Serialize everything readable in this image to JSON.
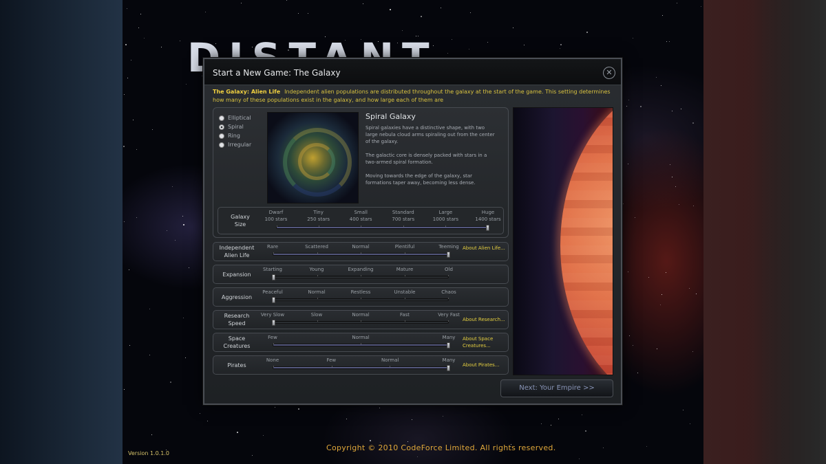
{
  "logo_text": "DISTANT",
  "version": "Version 1.0.1.0",
  "copyright": "Copyright © 2010 CodeForce Limited. All rights reserved.",
  "dialog": {
    "title": "Start a New Game: The Galaxy",
    "close_icon": "close-icon",
    "description_label": "The Galaxy: Alien Life",
    "description_text": "Independent alien populations are distributed throughout the galaxy at the start of the game. This setting determines how many of these populations exist in the galaxy, and how large each of them are",
    "galaxy_shapes": [
      {
        "label": "Elliptical",
        "selected": false
      },
      {
        "label": "Spiral",
        "selected": true
      },
      {
        "label": "Ring",
        "selected": false
      },
      {
        "label": "Irregular",
        "selected": false
      }
    ],
    "galaxy_heading": "Spiral Galaxy",
    "galaxy_paragraphs": [
      "Spiral galaxies have a distinctive shape, with two large nebula cloud arms spiraling out from the center of the galaxy.",
      "The galactic core is densely packed with stars in a two-armed spiral formation.",
      "Moving towards the edge of the galaxy, star formations taper away, becoming less dense."
    ],
    "galaxy_size": {
      "label": "Galaxy Size",
      "options": [
        {
          "name": "Dwarf",
          "stars": "100 stars"
        },
        {
          "name": "Tiny",
          "stars": "250 stars"
        },
        {
          "name": "Small",
          "stars": "400 stars"
        },
        {
          "name": "Standard",
          "stars": "700 stars"
        },
        {
          "name": "Large",
          "stars": "1000 stars"
        },
        {
          "name": "Huge",
          "stars": "1400 stars"
        }
      ],
      "value": 1.0
    },
    "settings": [
      {
        "label": "Independent Alien Life",
        "options": [
          "Rare",
          "Scattered",
          "Normal",
          "Plentiful",
          "Teeming"
        ],
        "value": 1.0,
        "about": "About Alien Life..."
      },
      {
        "label": "Expansion",
        "options": [
          "Starting",
          "Young",
          "Expanding",
          "Mature",
          "Old"
        ],
        "value": 0.0,
        "about": ""
      },
      {
        "label": "Aggression",
        "options": [
          "Peaceful",
          "Normal",
          "Restless",
          "Unstable",
          "Chaos"
        ],
        "value": 0.0,
        "about": ""
      },
      {
        "label": "Research Speed",
        "options": [
          "Very Slow",
          "Slow",
          "Normal",
          "Fast",
          "Very Fast"
        ],
        "value": 0.0,
        "about": "About Research..."
      },
      {
        "label": "Space Creatures",
        "options": [
          "Few",
          "Normal",
          "Many"
        ],
        "value": 1.0,
        "about": "About Space Creatures..."
      },
      {
        "label": "Pirates",
        "options": [
          "None",
          "Few",
          "Normal",
          "Many"
        ],
        "value": 1.0,
        "about": "About Pirates..."
      }
    ],
    "next_button": "Next: Your Empire >>"
  }
}
